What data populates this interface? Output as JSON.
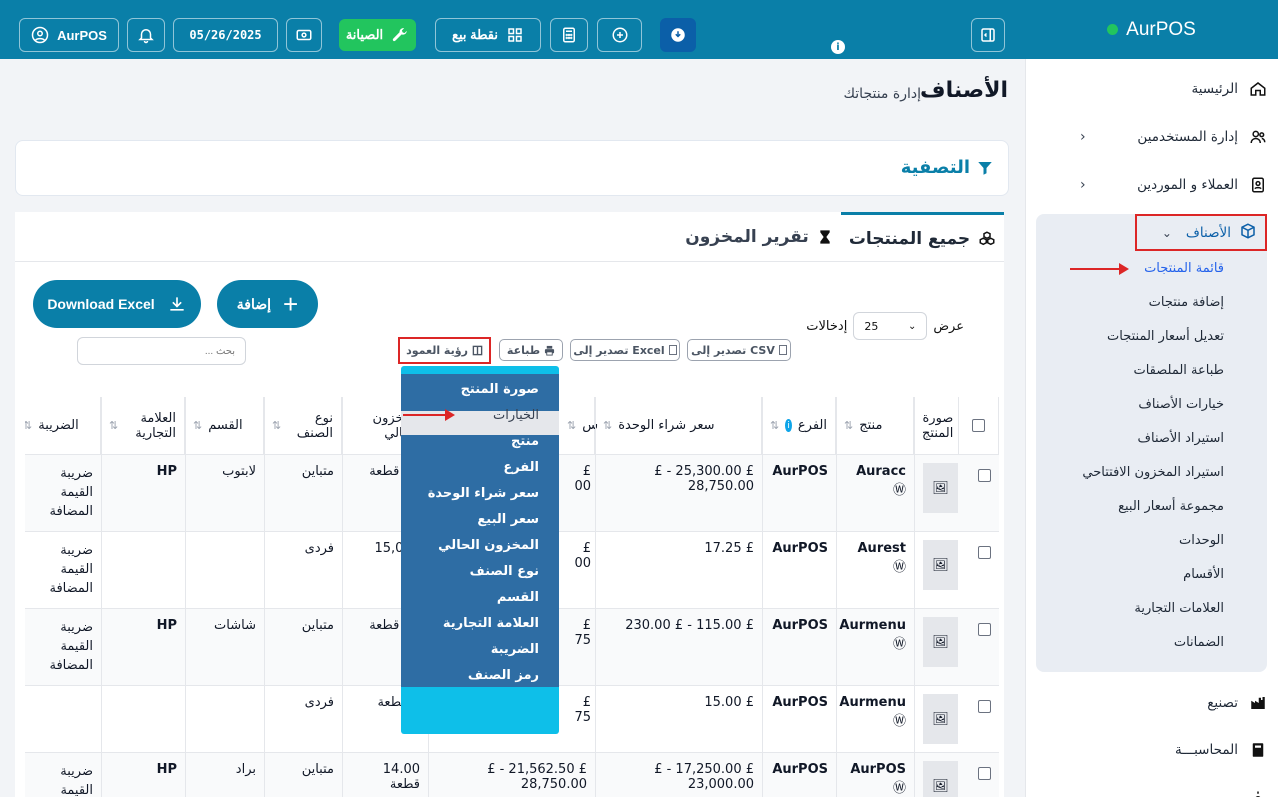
{
  "brand": {
    "name": "AurPOS",
    "status_color": "#22c55e"
  },
  "topbar": {
    "user_label": "AurPOS",
    "date": "05/26/2025",
    "maintenance_label": "الصيانة",
    "pos_label": "نقطة بيع"
  },
  "header": {
    "title": "الأصناف",
    "subtitle": "إدارة منتجاتك"
  },
  "filter": {
    "title": "التصفية"
  },
  "sidebar": {
    "items": [
      {
        "label": "الرئيسية",
        "icon": "home-icon"
      },
      {
        "label": "إدارة المستخدمين",
        "icon": "users-icon"
      },
      {
        "label": "العملاء و الموردين",
        "icon": "contacts-icon"
      },
      {
        "label": "الأصناف",
        "icon": "box-icon"
      },
      {
        "label": "تصنيع",
        "icon": "factory-icon"
      },
      {
        "label": "المحاسبـــة",
        "icon": "book-icon"
      }
    ],
    "submenu": [
      "قائمة المنتجات",
      "إضافة منتجات",
      "تعديل أسعار المنتجات",
      "طباعة الملصقات",
      "خيارات الأصناف",
      "استيراد الأصناف",
      "استيراد المخزون الافتتاحي",
      "مجموعة أسعار البيع",
      "الوحدات",
      "الأقسام",
      "العلامات التجارية",
      "الضمانات"
    ]
  },
  "tabs": {
    "all_products": "جميع المنتجات",
    "stock_report": "تقرير المخزون"
  },
  "actions": {
    "add": "إضافة",
    "download_excel": "Download Excel"
  },
  "entries": {
    "show": "عرض",
    "value": "25",
    "suffix": "إدخالات"
  },
  "toolbar": {
    "export_csv": "تصدير إلى CSV",
    "export_excel": "تصدير إلى Excel",
    "print": "طباعة",
    "column_visibility": "رؤية العمود",
    "search_placeholder": "بحث ..."
  },
  "colvis_menu": [
    "صورة المنتج",
    "الخيارات",
    "منتج",
    "الفرع",
    "سعر شراء الوحدة",
    "سعر البيع",
    "المخزون الحالي",
    "نوع الصنف",
    "القسم",
    "العلامة التجارية",
    "الضريبة",
    "رمز الصنف"
  ],
  "table": {
    "headers": {
      "image": "صورة المنتج",
      "product": "منتج",
      "branch": "الفرع",
      "purchase_price": "سعر شراء الوحدة",
      "sell_price": "س",
      "stock": "المخزون الحالي",
      "type": "نوع الصنف",
      "category": "القسم",
      "brand": "العلامة التجارية",
      "tax": "الضريبة"
    },
    "rows": [
      {
        "product": "Auracc",
        "branch": "AurPOS",
        "purchase": "£ 25,300.00 - £ 28,750.00",
        "sell": "£ 00",
        "stock": "26 قطعة",
        "type": "متباين",
        "category": "لابتوب",
        "brand": "HP",
        "tax": "ضريبة القيمة المضافة"
      },
      {
        "product": "Aurest",
        "branch": "AurPOS",
        "purchase": "£ 17.25",
        "sell": "£ 00",
        "stock": "15,000",
        "type": "فردى",
        "category": "",
        "brand": "",
        "tax": "ضريبة القيمة المضافة"
      },
      {
        "product": "Aurmenu",
        "branch": "AurPOS",
        "purchase": "£ 115.00 - £ 230.00",
        "sell": "£ 75",
        "stock": "89 قطعة",
        "type": "متباين",
        "category": "شاشات",
        "brand": "HP",
        "tax": "ضريبة القيمة المضافة"
      },
      {
        "product": "Aurmenu",
        "branch": "AurPOS",
        "purchase": "£ 15.00",
        "sell": "£ 75",
        "stock": "0 قطعة",
        "type": "فردى",
        "category": "",
        "brand": "",
        "tax": ""
      },
      {
        "product": "AurPOS",
        "branch": "AurPOS",
        "purchase": "£ 17,250.00 - £ 23,000.00",
        "sell": "£ 21,562.50 - £ 28,750.00",
        "stock": "14.00 قطعة",
        "type": "متباين",
        "category": "براد",
        "brand": "HP",
        "tax": "ضريبة القيمة"
      }
    ]
  },
  "colors": {
    "primary": "#0a7fa8",
    "highlight_border": "#dc2626",
    "menu_bg": "#2e6da4",
    "menu_edge": "#0ebfe9"
  }
}
